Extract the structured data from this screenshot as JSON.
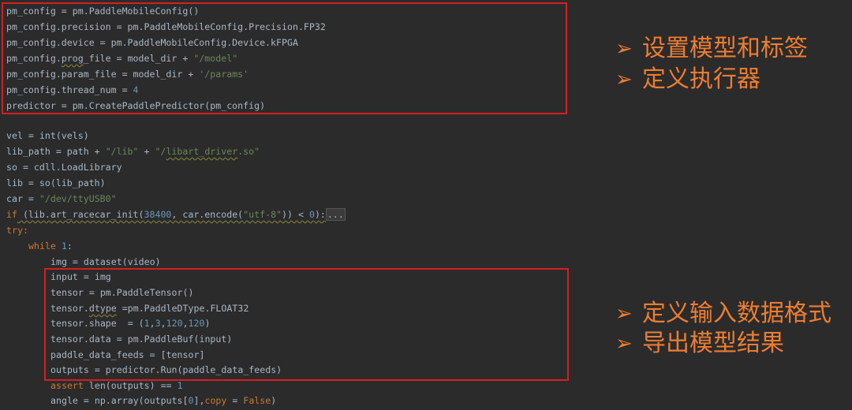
{
  "colors": {
    "background": "#2b2b2b",
    "code_text": "#a9b7c6",
    "keyword": "#cc7832",
    "string": "#6a8759",
    "number": "#6897bb",
    "highlight_box": "#d42020",
    "bullet_text": "#ed7d31"
  },
  "code": {
    "l1": "pm_config = pm.PaddleMobileConfig()",
    "l2": "pm_config.precision = pm.PaddleMobileConfig.Precision.FP32",
    "l3": "pm_config.device = pm.PaddleMobileConfig.Device.kFPGA",
    "l4a": "pm_config.",
    "l4b": "prog",
    "l4c": "_file = model_dir + ",
    "l4d": "\"/model\"",
    "l5a": "pm_config.param_file = model_dir + ",
    "l5b": "'/params'",
    "l6a": "pm_config.thread_num = ",
    "l6b": "4",
    "l7": "predictor = pm.CreatePaddlePredictor(pm_config)",
    "l8": "vel = int(vels)",
    "l9a": "lib_path = path + ",
    "l9b": "\"/lib\"",
    "l9c": " + ",
    "l9d": "\"/",
    "l9e": "libart_driver",
    "l9f": ".so\"",
    "l10": "so = cdll.LoadLibrary",
    "l11": "lib = so(lib_path)",
    "l12a": "car = ",
    "l12b": "\"/dev/ttyUSB0\"",
    "l13a": "if",
    "l13b": " (lib.art_racecar_init(",
    "l13c": "38400",
    "l13d": ", car.encode(",
    "l13e": "\"utf-8\"",
    "l13f": ")) < ",
    "l13g": "0",
    "l13h": "):",
    "l13i": "...",
    "l14": "try:",
    "l15a": "while",
    "l15b": " ",
    "l15c": "1",
    "l15d": ":",
    "l16": "img = dataset(video)",
    "l17": "input = img",
    "l18": "tensor = pm.PaddleTensor()",
    "l19a": "tensor.",
    "l19b": "dtype",
    "l19c": " =pm.PaddleDType.FLOAT32",
    "l20a": "tensor.shape  = (",
    "l20b": "1",
    "l20c": ",",
    "l20d": "3",
    "l20e": ",",
    "l20f": "120",
    "l20g": ",",
    "l20h": "120",
    "l20i": ")",
    "l21": "tensor.data = pm.PaddleBuf(input)",
    "l22": "paddle_data_feeds = [tensor]",
    "l23": "outputs = predictor.Run(paddle_data_feeds)",
    "l24a": "assert",
    "l24b": " len(outputs) == ",
    "l24c": "1",
    "l25a": "angle = np.array(outputs[",
    "l25b": "0",
    "l25c": "],",
    "l25d": "copy",
    "l25e": " = ",
    "l25f": "False",
    "l25g": ")"
  },
  "bullets": {
    "arrow": "➢",
    "b1": "设置模型和标签",
    "b2": "定义执行器",
    "b3": "定义输入数据格式",
    "b4": "导出模型结果"
  }
}
